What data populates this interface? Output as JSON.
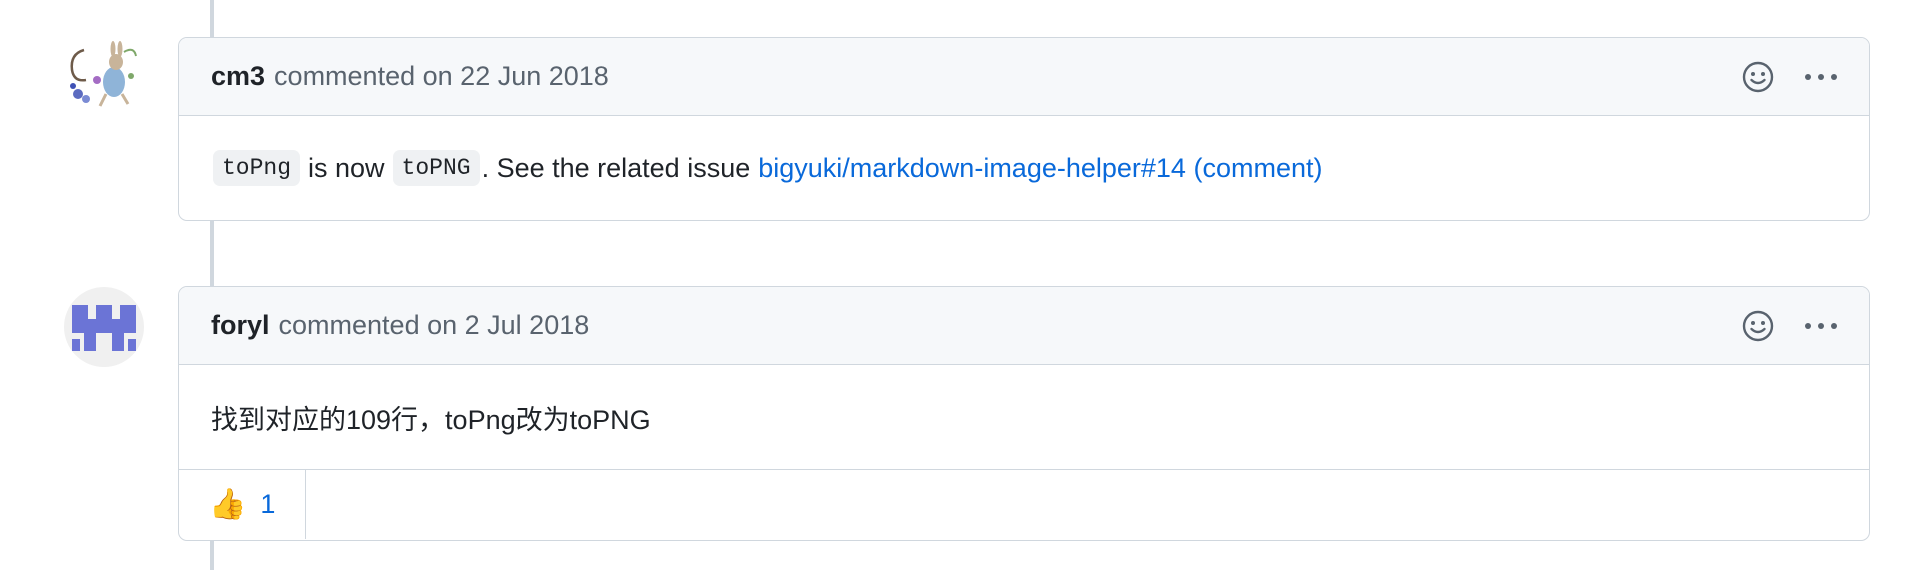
{
  "comments": [
    {
      "author": "cm3",
      "action": "commented on",
      "date": "22 Jun 2018",
      "body": {
        "code1": "toPng",
        "text1": "is now",
        "code2": "toPNG",
        "text2": ". See the related issue",
        "link": "bigyuki/markdown-image-helper#14 (comment)"
      }
    },
    {
      "author": "foryl",
      "action": "commented on",
      "date": "2 Jul 2018",
      "body": {
        "text": "找到对应的109行，toPng改为toPNG"
      },
      "reactions": [
        {
          "emoji": "👍",
          "icon": "thumbs-up",
          "count": "1"
        }
      ]
    }
  ],
  "colors": {
    "link": "#0969da",
    "border": "#d0d7de",
    "header_bg": "#f6f8fa",
    "muted": "#59636e",
    "identicon": "#6b74d6"
  }
}
